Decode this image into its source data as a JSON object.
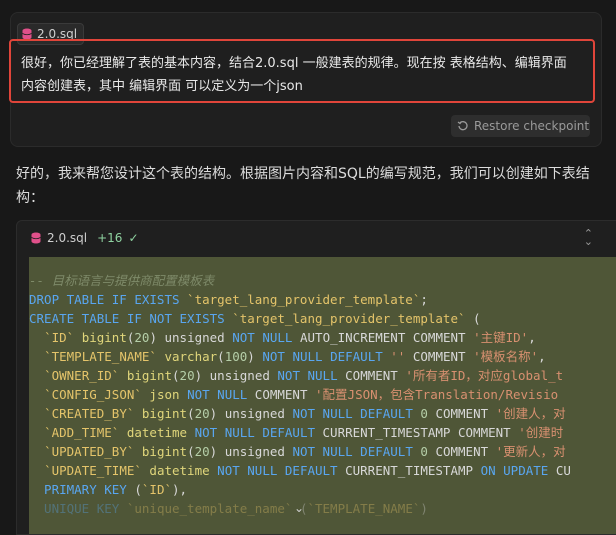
{
  "user_message": {
    "file_chip": "2.0.sql",
    "text": "很好，你已经理解了表的基本内容，结合2.0.sql 一般建表的规律。现在按 表格结构、编辑界面 内容创建表，其中 编辑界面 可以定义为一个json",
    "restore_label": "Restore checkpoint"
  },
  "assistant": {
    "reply": "好的，我来帮您设计这个表的结构。根据图片内容和SQL的编写规范，我们可以创建如下表结构："
  },
  "code_block": {
    "filename": "2.0.sql",
    "diff": "+16",
    "lines": [
      [
        {
          "c": "cmt",
          "t": "-- 目标语言与提供商配置模板表"
        }
      ],
      [
        {
          "c": "kw",
          "t": "DROP TABLE IF EXISTS "
        },
        {
          "c": "id",
          "t": "`target_lang_provider_template`"
        },
        {
          "c": "plain",
          "t": ";"
        }
      ],
      [
        {
          "c": "kw",
          "t": "CREATE TABLE IF NOT EXISTS "
        },
        {
          "c": "id",
          "t": "`target_lang_provider_template`"
        },
        {
          "c": "plain",
          "t": " ("
        }
      ],
      [
        {
          "c": "plain",
          "t": "  "
        },
        {
          "c": "id",
          "t": "`ID`"
        },
        {
          "c": "ty",
          "t": " bigint"
        },
        {
          "c": "plain",
          "t": "("
        },
        {
          "c": "num",
          "t": "20"
        },
        {
          "c": "plain",
          "t": ") unsigned "
        },
        {
          "c": "kw",
          "t": "NOT NULL"
        },
        {
          "c": "plain",
          "t": " AUTO_INCREMENT COMMENT "
        },
        {
          "c": "str",
          "t": "'主键ID'"
        },
        {
          "c": "plain",
          "t": ","
        }
      ],
      [
        {
          "c": "plain",
          "t": "  "
        },
        {
          "c": "id",
          "t": "`TEMPLATE_NAME`"
        },
        {
          "c": "ty",
          "t": " varchar"
        },
        {
          "c": "plain",
          "t": "("
        },
        {
          "c": "num",
          "t": "100"
        },
        {
          "c": "plain",
          "t": ") "
        },
        {
          "c": "kw",
          "t": "NOT NULL DEFAULT "
        },
        {
          "c": "str",
          "t": "''"
        },
        {
          "c": "plain",
          "t": " COMMENT "
        },
        {
          "c": "str",
          "t": "'模板名称'"
        },
        {
          "c": "plain",
          "t": ","
        }
      ],
      [
        {
          "c": "plain",
          "t": "  "
        },
        {
          "c": "id",
          "t": "`OWNER_ID`"
        },
        {
          "c": "ty",
          "t": " bigint"
        },
        {
          "c": "plain",
          "t": "("
        },
        {
          "c": "num",
          "t": "20"
        },
        {
          "c": "plain",
          "t": ") unsigned "
        },
        {
          "c": "kw",
          "t": "NOT NULL"
        },
        {
          "c": "plain",
          "t": " COMMENT "
        },
        {
          "c": "str",
          "t": "'所有者ID，对应global_t"
        }
      ],
      [
        {
          "c": "plain",
          "t": "  "
        },
        {
          "c": "id",
          "t": "`CONFIG_JSON`"
        },
        {
          "c": "ty",
          "t": " json"
        },
        {
          "c": "kw",
          "t": " NOT NULL"
        },
        {
          "c": "plain",
          "t": " COMMENT "
        },
        {
          "c": "str",
          "t": "'配置JSON，包含Translation/Revisio"
        }
      ],
      [
        {
          "c": "plain",
          "t": "  "
        },
        {
          "c": "id",
          "t": "`CREATED_BY`"
        },
        {
          "c": "ty",
          "t": " bigint"
        },
        {
          "c": "plain",
          "t": "("
        },
        {
          "c": "num",
          "t": "20"
        },
        {
          "c": "plain",
          "t": ") unsigned "
        },
        {
          "c": "kw",
          "t": "NOT NULL DEFAULT "
        },
        {
          "c": "num",
          "t": "0"
        },
        {
          "c": "plain",
          "t": " COMMENT "
        },
        {
          "c": "str",
          "t": "'创建人，对"
        }
      ],
      [
        {
          "c": "plain",
          "t": "  "
        },
        {
          "c": "id",
          "t": "`ADD_TIME`"
        },
        {
          "c": "ty",
          "t": " datetime"
        },
        {
          "c": "kw",
          "t": " NOT NULL DEFAULT"
        },
        {
          "c": "plain",
          "t": " CURRENT_TIMESTAMP COMMENT "
        },
        {
          "c": "str",
          "t": "'创建时"
        }
      ],
      [
        {
          "c": "plain",
          "t": "  "
        },
        {
          "c": "id",
          "t": "`UPDATED_BY`"
        },
        {
          "c": "ty",
          "t": " bigint"
        },
        {
          "c": "plain",
          "t": "("
        },
        {
          "c": "num",
          "t": "20"
        },
        {
          "c": "plain",
          "t": ") unsigned "
        },
        {
          "c": "kw",
          "t": "NOT NULL DEFAULT "
        },
        {
          "c": "num",
          "t": "0"
        },
        {
          "c": "plain",
          "t": " COMMENT "
        },
        {
          "c": "str",
          "t": "'更新人，对"
        }
      ],
      [
        {
          "c": "plain",
          "t": "  "
        },
        {
          "c": "id",
          "t": "`UPDATE_TIME`"
        },
        {
          "c": "ty",
          "t": " datetime"
        },
        {
          "c": "kw",
          "t": " NOT NULL DEFAULT"
        },
        {
          "c": "plain",
          "t": " CURRENT_TIMESTAMP "
        },
        {
          "c": "kw",
          "t": "ON UPDATE"
        },
        {
          "c": "plain",
          "t": " CU"
        }
      ],
      [
        {
          "c": "kw",
          "t": "  PRIMARY KEY"
        },
        {
          "c": "plain",
          "t": " ("
        },
        {
          "c": "id",
          "t": "`ID`"
        },
        {
          "c": "plain",
          "t": "),"
        }
      ],
      [
        {
          "c": "kw",
          "t": "  UNIQUE KEY"
        },
        {
          "c": "plain",
          "t": " "
        },
        {
          "c": "id",
          "t": "`unique_template_name`"
        },
        {
          "c": "plain",
          "t": " ("
        },
        {
          "c": "id",
          "t": "`TEMPLATE_NAME`"
        },
        {
          "c": "plain",
          "t": ")"
        }
      ]
    ]
  }
}
